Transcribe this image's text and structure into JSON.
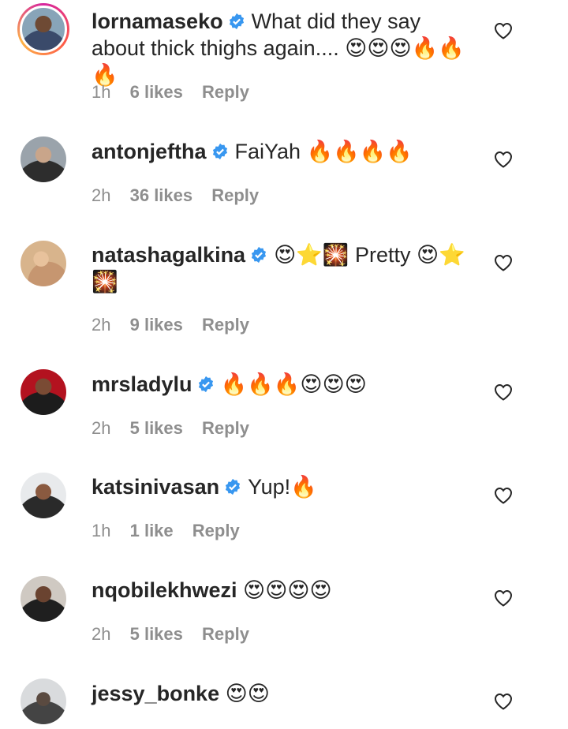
{
  "comments": [
    {
      "username": "lornamaseko",
      "text": "What did they say about thick thighs again.... 😍😍😍🔥🔥🔥",
      "time": "1h",
      "likes": "6 likes",
      "reply": "Reply"
    },
    {
      "username": "antonjeftha",
      "text": "FaiYah 🔥🔥🔥🔥",
      "time": "2h",
      "likes": "36 likes",
      "reply": "Reply"
    },
    {
      "username": "natashagalkina",
      "text": "😍⭐🎇 Pretty 😍⭐🎇",
      "time": "2h",
      "likes": "9 likes",
      "reply": "Reply"
    },
    {
      "username": "mrsladylu",
      "text": "🔥🔥🔥😍😍😍",
      "time": "2h",
      "likes": "5 likes",
      "reply": "Reply"
    },
    {
      "username": "katsinivasan",
      "text": "Yup!🔥",
      "time": "1h",
      "likes": "1 like",
      "reply": "Reply"
    },
    {
      "username": "nqobilekhwezi",
      "text": "😍😍😍😍",
      "time": "2h",
      "likes": "5 likes",
      "reply": "Reply"
    },
    {
      "username": "jessy_bonke",
      "text": "😍😍"
    }
  ],
  "icons": {
    "verified": "verified-badge-icon",
    "like": "heart-outline-icon"
  },
  "colors": {
    "verified": "#3897f0",
    "meta": "#8e8e8e",
    "text": "#262626"
  }
}
